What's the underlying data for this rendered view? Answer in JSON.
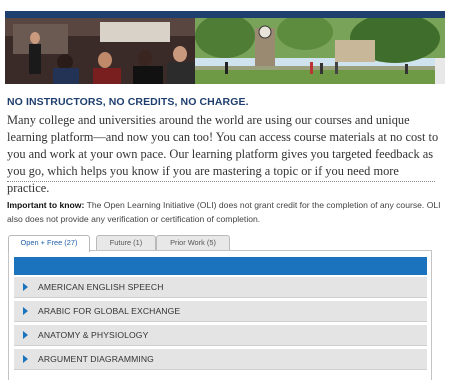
{
  "headline": "NO INSTRUCTORS, NO CREDITS, NO CHARGE.",
  "intro": "Many college and universities around the world are using our courses and unique learning platform—and now you can too! You can access course materials at no cost to you and work at your own pace. Our learning platform gives you targeted feedback as you go, which helps you know if you are mastering a topic or if you need more practice.",
  "important": {
    "label": "Important to know:",
    "text": " The Open Learning Initiative (OLI) does not grant credit for the completion of any course. OLI also does not provide any verification or certification of completion."
  },
  "tabs": [
    {
      "label": "Open + Free (27)",
      "active": true
    },
    {
      "label": "Future (1)",
      "active": false
    },
    {
      "label": "Prior Work (5)",
      "active": false
    }
  ],
  "courses": [
    {
      "label": "AMERICAN ENGLISH SPEECH"
    },
    {
      "label": "ARABIC FOR GLOBAL EXCHANGE"
    },
    {
      "label": "ANATOMY & PHYSIOLOGY"
    },
    {
      "label": "ARGUMENT DIAGRAMMING"
    }
  ],
  "colors": {
    "brand_navy": "#1f3f6f",
    "accent_blue": "#1b73bd",
    "row_gray": "#e4e4e4"
  }
}
